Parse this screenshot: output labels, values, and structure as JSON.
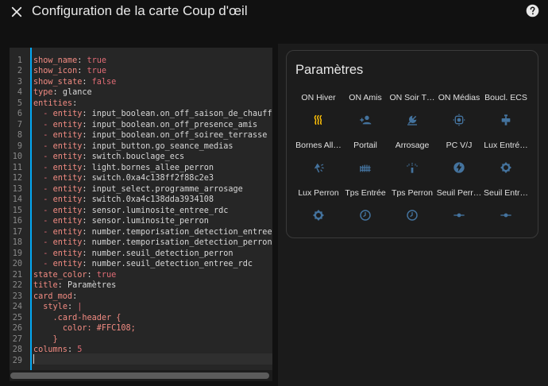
{
  "header": {
    "title": "Configuration de la carte Coup d'œil",
    "close_icon": "close-icon",
    "help_icon": "help-circle-icon"
  },
  "editor": {
    "lines": [
      {
        "n": "1",
        "t": [
          [
            "k",
            "show_name"
          ],
          [
            "v",
            ": "
          ],
          [
            "b",
            "true"
          ]
        ]
      },
      {
        "n": "2",
        "t": [
          [
            "k",
            "show_icon"
          ],
          [
            "v",
            ": "
          ],
          [
            "b",
            "true"
          ]
        ]
      },
      {
        "n": "3",
        "t": [
          [
            "k",
            "show_state"
          ],
          [
            "v",
            ": "
          ],
          [
            "b",
            "false"
          ]
        ]
      },
      {
        "n": "4",
        "t": [
          [
            "k",
            "type"
          ],
          [
            "v",
            ": glance"
          ]
        ]
      },
      {
        "n": "5",
        "t": [
          [
            "k",
            "entities"
          ],
          [
            "v",
            ":"
          ]
        ]
      },
      {
        "n": "6",
        "t": [
          [
            "v",
            "  "
          ],
          [
            "dash",
            "-"
          ],
          [
            "v",
            " "
          ],
          [
            "k",
            "entity"
          ],
          [
            "v",
            ": input_boolean.on_off_saison_de_chauffe"
          ]
        ]
      },
      {
        "n": "7",
        "t": [
          [
            "v",
            "  "
          ],
          [
            "dash",
            "-"
          ],
          [
            "v",
            " "
          ],
          [
            "k",
            "entity"
          ],
          [
            "v",
            ": input_boolean.on_off_presence_amis"
          ]
        ]
      },
      {
        "n": "8",
        "t": [
          [
            "v",
            "  "
          ],
          [
            "dash",
            "-"
          ],
          [
            "v",
            " "
          ],
          [
            "k",
            "entity"
          ],
          [
            "v",
            ": input_boolean.on_off_soiree_terrasse"
          ]
        ]
      },
      {
        "n": "9",
        "t": [
          [
            "v",
            "  "
          ],
          [
            "dash",
            "-"
          ],
          [
            "v",
            " "
          ],
          [
            "k",
            "entity"
          ],
          [
            "v",
            ": input_button.go_seance_medias"
          ]
        ]
      },
      {
        "n": "10",
        "t": [
          [
            "v",
            "  "
          ],
          [
            "dash",
            "-"
          ],
          [
            "v",
            " "
          ],
          [
            "k",
            "entity"
          ],
          [
            "v",
            ": switch.bouclage_ecs"
          ]
        ]
      },
      {
        "n": "11",
        "t": [
          [
            "v",
            "  "
          ],
          [
            "dash",
            "-"
          ],
          [
            "v",
            " "
          ],
          [
            "k",
            "entity"
          ],
          [
            "v",
            ": light.bornes_allee_perron"
          ]
        ]
      },
      {
        "n": "12",
        "t": [
          [
            "v",
            "  "
          ],
          [
            "dash",
            "-"
          ],
          [
            "v",
            " "
          ],
          [
            "k",
            "entity"
          ],
          [
            "v",
            ": switch.0xa4c138ff2f88c2e3"
          ]
        ]
      },
      {
        "n": "13",
        "t": [
          [
            "v",
            "  "
          ],
          [
            "dash",
            "-"
          ],
          [
            "v",
            " "
          ],
          [
            "k",
            "entity"
          ],
          [
            "v",
            ": input_select.programme_arrosage"
          ]
        ]
      },
      {
        "n": "14",
        "t": [
          [
            "v",
            "  "
          ],
          [
            "dash",
            "-"
          ],
          [
            "v",
            " "
          ],
          [
            "k",
            "entity"
          ],
          [
            "v",
            ": switch.0xa4c138dda3934108"
          ]
        ]
      },
      {
        "n": "15",
        "t": [
          [
            "v",
            "  "
          ],
          [
            "dash",
            "-"
          ],
          [
            "v",
            " "
          ],
          [
            "k",
            "entity"
          ],
          [
            "v",
            ": sensor.luminosite_entree_rdc"
          ]
        ]
      },
      {
        "n": "16",
        "t": [
          [
            "v",
            "  "
          ],
          [
            "dash",
            "-"
          ],
          [
            "v",
            " "
          ],
          [
            "k",
            "entity"
          ],
          [
            "v",
            ": sensor.luminosite_perron"
          ]
        ]
      },
      {
        "n": "17",
        "t": [
          [
            "v",
            "  "
          ],
          [
            "dash",
            "-"
          ],
          [
            "v",
            " "
          ],
          [
            "k",
            "entity"
          ],
          [
            "v",
            ": number.temporisation_detection_entree"
          ]
        ]
      },
      {
        "n": "18",
        "t": [
          [
            "v",
            "  "
          ],
          [
            "dash",
            "-"
          ],
          [
            "v",
            " "
          ],
          [
            "k",
            "entity"
          ],
          [
            "v",
            ": number.temporisation_detection_perron"
          ]
        ]
      },
      {
        "n": "19",
        "t": [
          [
            "v",
            "  "
          ],
          [
            "dash",
            "-"
          ],
          [
            "v",
            " "
          ],
          [
            "k",
            "entity"
          ],
          [
            "v",
            ": number.seuil_detection_perron"
          ]
        ]
      },
      {
        "n": "20",
        "t": [
          [
            "v",
            "  "
          ],
          [
            "dash",
            "-"
          ],
          [
            "v",
            " "
          ],
          [
            "k",
            "entity"
          ],
          [
            "v",
            ": number.seuil_detection_entree_rdc"
          ]
        ]
      },
      {
        "n": "21",
        "t": [
          [
            "k",
            "state_color"
          ],
          [
            "v",
            ": "
          ],
          [
            "b",
            "true"
          ]
        ]
      },
      {
        "n": "22",
        "t": [
          [
            "k",
            "title"
          ],
          [
            "v",
            ": Paramètres"
          ]
        ]
      },
      {
        "n": "23",
        "t": [
          [
            "k",
            "card_mod"
          ],
          [
            "v",
            ":"
          ]
        ]
      },
      {
        "n": "24",
        "t": [
          [
            "v",
            "  "
          ],
          [
            "k",
            "style"
          ],
          [
            "v",
            ": "
          ],
          [
            "b",
            "|"
          ]
        ]
      },
      {
        "n": "25",
        "t": [
          [
            "v",
            "    "
          ],
          [
            "k",
            ".card-header {"
          ]
        ]
      },
      {
        "n": "26",
        "t": [
          [
            "v",
            "      "
          ],
          [
            "k",
            "color: #FFC108;"
          ]
        ]
      },
      {
        "n": "27",
        "t": [
          [
            "v",
            "    "
          ],
          [
            "k",
            "}"
          ]
        ]
      },
      {
        "n": "28",
        "t": [
          [
            "k",
            "columns"
          ],
          [
            "v",
            ": "
          ],
          [
            "n",
            "5"
          ]
        ]
      },
      {
        "n": "29",
        "t": []
      }
    ]
  },
  "card": {
    "title": "Paramètres",
    "entities": [
      {
        "name": "ON Hiver",
        "icon": "radiator-icon",
        "color": "#ffc107"
      },
      {
        "name": "ON Amis",
        "icon": "account-plus-icon",
        "color": "#44739e"
      },
      {
        "name": "ON Soir T…",
        "icon": "weather-night-icon",
        "color": "#44739e"
      },
      {
        "name": "ON Médias",
        "icon": "gesture-tap-button-icon",
        "color": "#44739e"
      },
      {
        "name": "Boucl. ECS",
        "icon": "water-pump-icon",
        "color": "#44739e"
      },
      {
        "name": "Bornes All…",
        "icon": "outdoor-lamp-icon",
        "color": "#44739e"
      },
      {
        "name": "Portail",
        "icon": "gate-icon",
        "color": "#44739e"
      },
      {
        "name": "Arrosage",
        "icon": "sprinkler-icon",
        "color": "#44739e"
      },
      {
        "name": "PC V/J",
        "icon": "flash-icon",
        "color": "#44739e"
      },
      {
        "name": "Lux Entré…",
        "icon": "brightness-icon",
        "color": "#44739e"
      },
      {
        "name": "Lux Perron",
        "icon": "brightness-icon",
        "color": "#44739e"
      },
      {
        "name": "Tps Entrée",
        "icon": "timer-icon",
        "color": "#44739e"
      },
      {
        "name": "Tps Perron",
        "icon": "timer-icon",
        "color": "#44739e"
      },
      {
        "name": "Seuil Perr…",
        "icon": "ray-vertex-icon",
        "color": "#44739e"
      },
      {
        "name": "Seuil Entr…",
        "icon": "ray-vertex-icon",
        "color": "#44739e"
      }
    ]
  },
  "colors": {
    "accent": "#03a9f4",
    "icon_default": "#44739e",
    "icon_active": "#ffc107"
  }
}
